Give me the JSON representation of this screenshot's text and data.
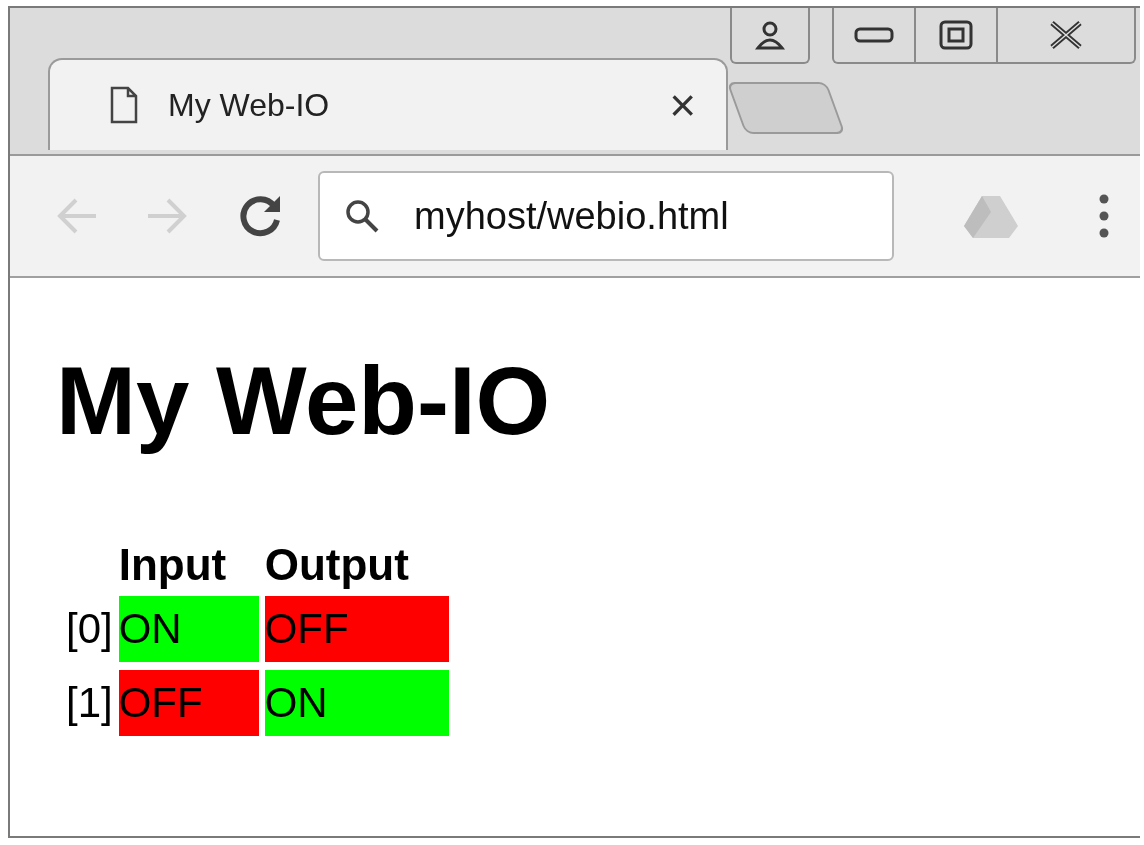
{
  "tab": {
    "title": "My Web-IO",
    "close": "×"
  },
  "address": {
    "value": "myhost/webio.html"
  },
  "page": {
    "heading": "My Web-IO",
    "columns": [
      "Input",
      "Output"
    ],
    "rows": [
      {
        "label": "[0]",
        "input": {
          "text": "ON",
          "on": true
        },
        "output": {
          "text": "OFF",
          "on": false
        }
      },
      {
        "label": "[1]",
        "input": {
          "text": "OFF",
          "on": false
        },
        "output": {
          "text": "ON",
          "on": true
        }
      }
    ]
  }
}
